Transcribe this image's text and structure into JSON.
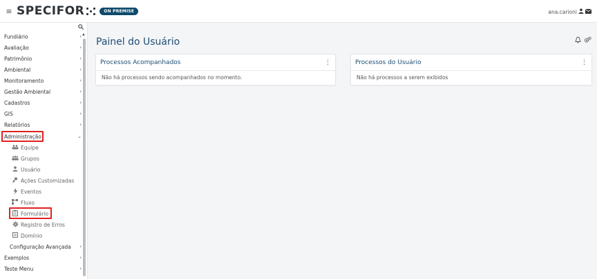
{
  "header": {
    "logo": "SPECIFOR",
    "badge": "ON PREMISE",
    "user": "ana.carioni"
  },
  "sidebar": {
    "items": [
      {
        "label": "Fundiário"
      },
      {
        "label": "Avaliação"
      },
      {
        "label": "Patrimônio"
      },
      {
        "label": "Ambiental"
      },
      {
        "label": "Monitoramento"
      },
      {
        "label": "Gestão Ambiental"
      },
      {
        "label": "Cadastros"
      },
      {
        "label": "GIS"
      },
      {
        "label": "Relatórios"
      },
      {
        "label": "Administração"
      }
    ],
    "subitems": [
      {
        "label": "Equipe",
        "icon": "team-icon"
      },
      {
        "label": "Grupos",
        "icon": "groups-icon"
      },
      {
        "label": "Usuário",
        "icon": "user-icon"
      },
      {
        "label": "Ações Customizadas",
        "icon": "custom-actions-icon"
      },
      {
        "label": "Eventos",
        "icon": "lightning-icon"
      },
      {
        "label": "Fluxo",
        "icon": "flow-icon"
      },
      {
        "label": "Formulário",
        "icon": "form-icon"
      },
      {
        "label": "Registro de Erros",
        "icon": "bug-icon"
      },
      {
        "label": "Domínio",
        "icon": "domain-icon"
      }
    ],
    "config_avancada": "Configuração Avançada",
    "bottom_items": [
      {
        "label": "Exemplos"
      },
      {
        "label": "Teste Menu"
      }
    ]
  },
  "main": {
    "title": "Painel do Usuário",
    "cards": [
      {
        "title": "Processos Acompanhados",
        "body": "Não há processos sendo acompanhados no momento."
      },
      {
        "title": "Processos do Usuário",
        "body": "Não há processos a serem exibidos"
      }
    ]
  },
  "colors": {
    "accent": "#1d4e74",
    "badge": "#0e4a6b",
    "highlight": "#e02020"
  }
}
